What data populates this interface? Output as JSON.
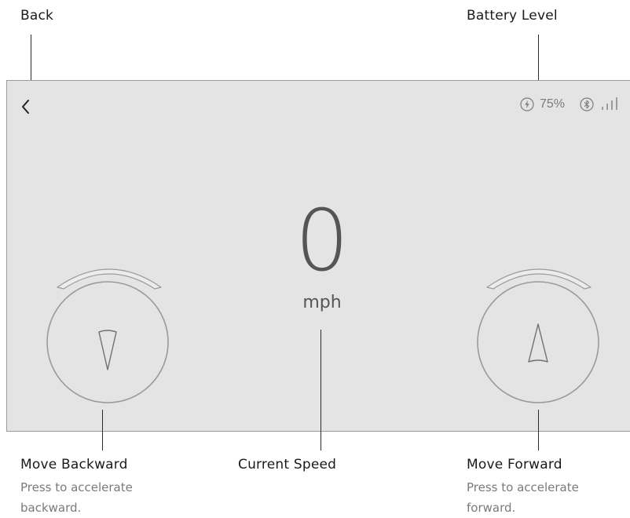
{
  "annotations": {
    "back": {
      "title": "Back"
    },
    "battery": {
      "title": "Battery Level"
    },
    "backward": {
      "title": "Move Backward",
      "description": "Press to accelerate backward."
    },
    "speed": {
      "title": "Current Speed"
    },
    "forward": {
      "title": "Move Forward",
      "description": "Press to accelerate forward."
    }
  },
  "screen": {
    "status": {
      "battery_percent": "75%",
      "battery_icon": "charging-bolt-icon",
      "bluetooth_icon": "bluetooth-icon",
      "signal_icon": "signal-bars-icon"
    },
    "speed": {
      "value": "0",
      "unit": "mph"
    },
    "back_icon": "chevron-left-icon",
    "backward_icon": "arrow-down-icon",
    "forward_icon": "arrow-up-icon"
  },
  "colors": {
    "screen_bg": "#e4e4e4",
    "icon_gray": "#7c7c7c",
    "speed_text": "#555555",
    "label_text": "#1a1a1a",
    "desc_text": "#7a7a7a"
  }
}
